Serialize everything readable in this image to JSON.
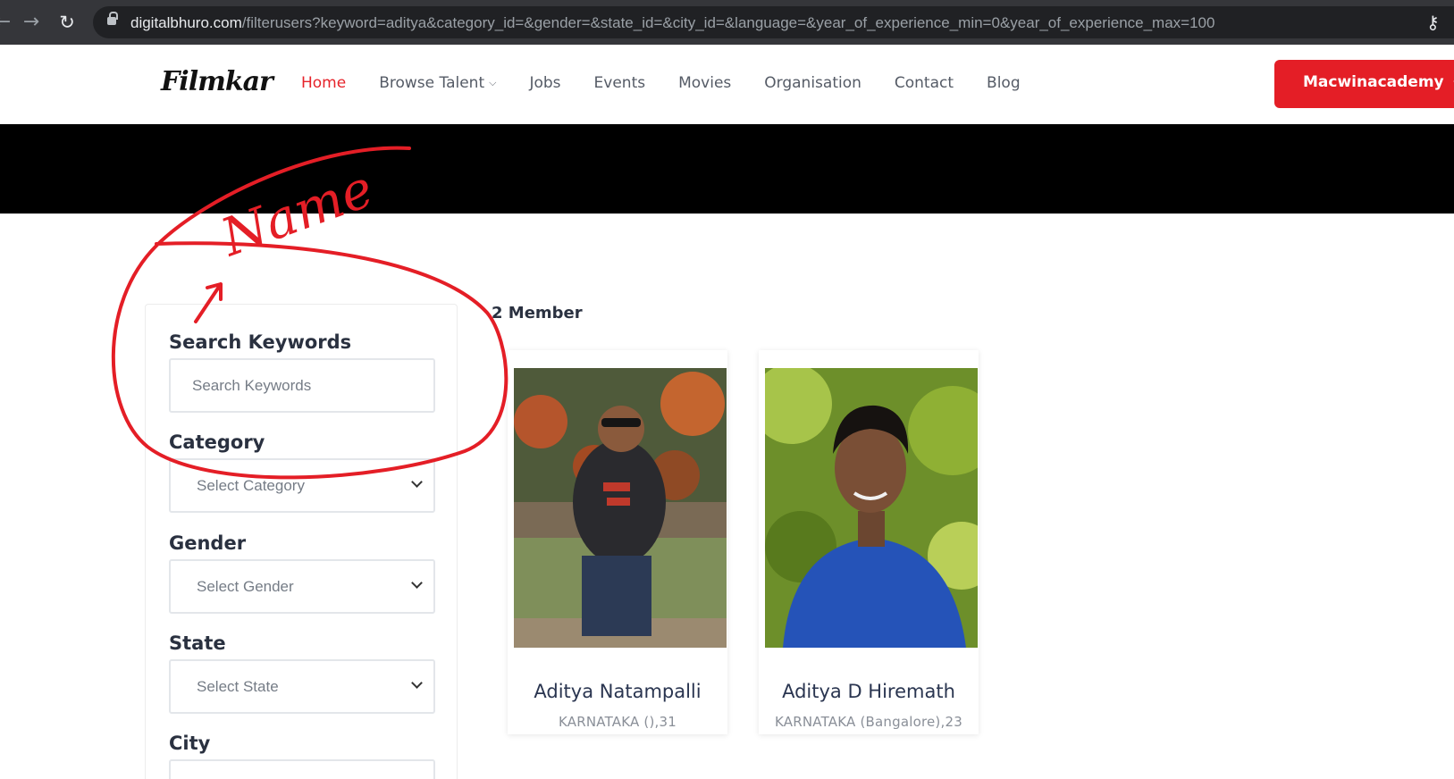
{
  "browser": {
    "url_host": "digitalbhuro.com",
    "url_path": "/filterusers?keyword=aditya&category_id=&gender=&state_id=&city_id=&language=&year_of_experience_min=0&year_of_experience_max=100"
  },
  "header": {
    "logo": "Filmkar",
    "nav": [
      "Home",
      "Browse Talent",
      "Jobs",
      "Events",
      "Movies",
      "Organisation",
      "Contact",
      "Blog"
    ],
    "account_button": "Macwinacademy",
    "accent_color": "#e41e26"
  },
  "filters": {
    "keyword_label": "Search Keywords",
    "keyword_placeholder": "Search Keywords",
    "category_label": "Category",
    "category_value": "Select Category",
    "gender_label": "Gender",
    "gender_value": "Select Gender",
    "state_label": "State",
    "state_value": "Select State",
    "city_label": "City"
  },
  "results": {
    "count_text": "2 Member",
    "members": [
      {
        "name": "Aditya Natampalli",
        "meta": "KARNATAKA (),31"
      },
      {
        "name": "Aditya D Hiremath",
        "meta": "KARNATAKA (Bangalore),23"
      }
    ]
  },
  "annotation": {
    "text": "Name",
    "color": "#e41e26"
  }
}
